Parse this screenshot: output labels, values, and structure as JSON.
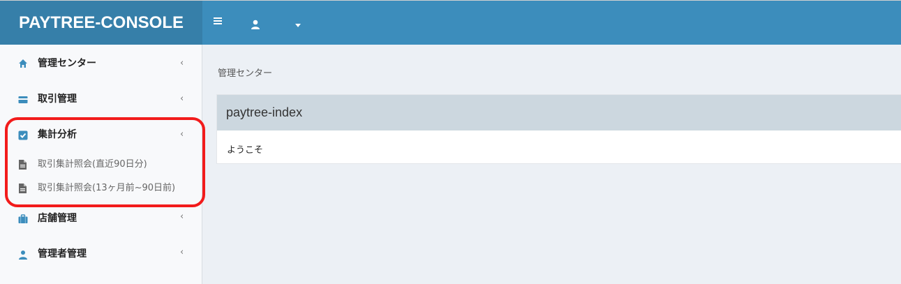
{
  "header": {
    "brand": "PAYTREE-CONSOLE",
    "colors": {
      "header_bg": "#3c8dbc",
      "logo_bg": "#367fa9"
    }
  },
  "sidebar": {
    "items": [
      {
        "label": "管理センター",
        "icon": "home-icon",
        "chevron": "‹"
      },
      {
        "label": "取引管理",
        "icon": "credit-card-icon",
        "chevron": "‹"
      },
      {
        "label": "集計分析",
        "icon": "checkbox-icon",
        "chevron": "‹",
        "children": [
          {
            "label": "取引集計照会(直近90日分)",
            "icon": "file-icon"
          },
          {
            "label": "取引集計照会(13ヶ月前~90日前)",
            "icon": "file-icon"
          }
        ]
      },
      {
        "label": "店舗管理",
        "icon": "briefcase-icon",
        "chevron": "‹"
      },
      {
        "label": "管理者管理",
        "icon": "user-icon",
        "chevron": "‹"
      }
    ],
    "highlight_color": "#f21b1b"
  },
  "main": {
    "breadcrumb": "管理センター",
    "box": {
      "title": "paytree-index",
      "body": "ようこそ"
    }
  }
}
